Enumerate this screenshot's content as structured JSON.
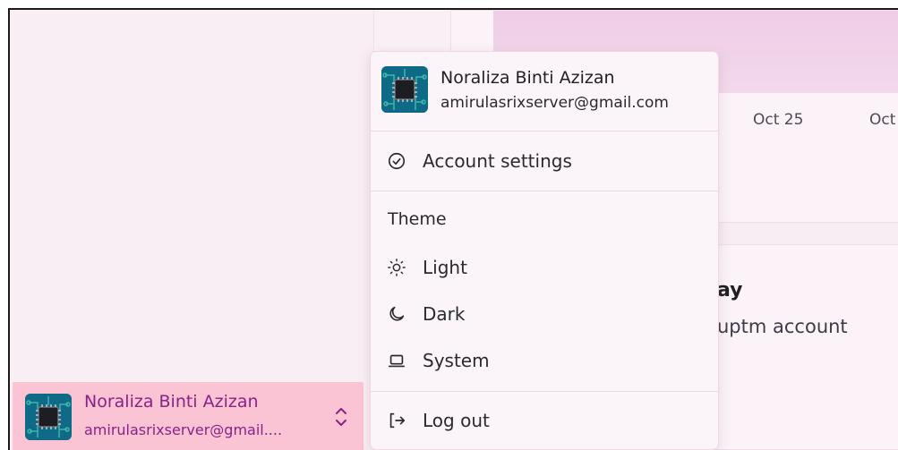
{
  "user": {
    "name": "Noraliza Binti Azizan",
    "email": "amirulasrixserver@gmail.com",
    "email_truncated": "amirulasrixserver@gmail...."
  },
  "background": {
    "dates": [
      "Oct 25",
      "Oct"
    ],
    "card_title_fragment": "ay",
    "card_subtitle_fragment": "uptm account"
  },
  "menu": {
    "account_settings": "Account settings",
    "theme_label": "Theme",
    "theme_options": [
      "Light",
      "Dark",
      "System"
    ],
    "logout": "Log out"
  },
  "icons": {
    "account_settings": "circle-check-icon",
    "light": "sun-icon",
    "dark": "moon-icon",
    "system": "laptop-icon",
    "logout": "log-out-icon",
    "chip": "chevrons-up-down-icon"
  },
  "colors": {
    "accent": "#8a2187",
    "chip_bg": "#fbc4d4",
    "avatar_bg": "#0e6a86"
  }
}
